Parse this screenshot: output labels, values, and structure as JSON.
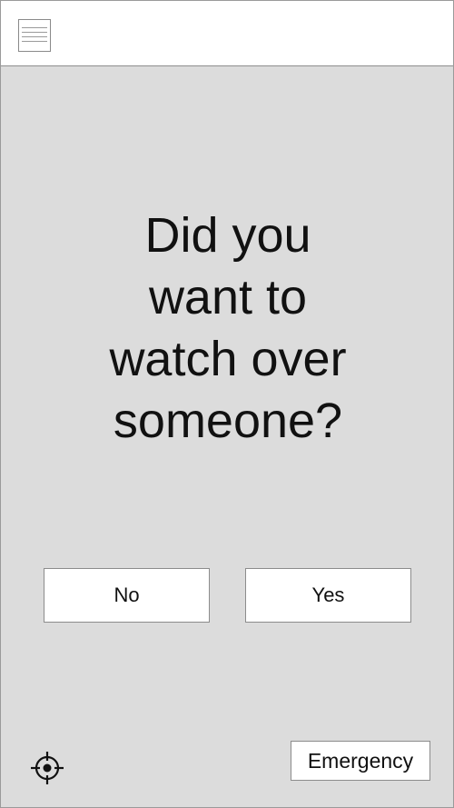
{
  "header": {
    "menu_icon": "hamburger-menu-icon"
  },
  "main": {
    "question": "Did you\nwant to\nwatch over\nsomeone?",
    "no_label": "No",
    "yes_label": "Yes",
    "emergency_label": "Emergency",
    "locate_icon": "crosshair-locate-icon"
  },
  "colors": {
    "background": "#dcdcdc",
    "header_background": "#ffffff",
    "button_background": "#ffffff",
    "text": "#111111",
    "border": "#8c8c8c"
  }
}
